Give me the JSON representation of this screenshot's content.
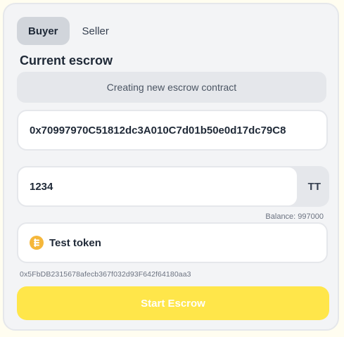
{
  "tabs": [
    {
      "label": "Buyer",
      "active": true
    },
    {
      "label": "Seller",
      "active": false
    }
  ],
  "section_title": "Current escrow",
  "status_text": "Creating new escrow contract",
  "address_value": "0x70997970C51812dc3A010C7d01b50e0d17dc79C8",
  "amount": {
    "value": "1234",
    "unit": "TT",
    "balance": "Balance: 997000"
  },
  "token": {
    "name": "Test token",
    "icon": "token-coin-icon",
    "address": "0x5FbDB2315678afecb367f032d93F642f64180aa3"
  },
  "start_button_label": "Start Escrow",
  "colors": {
    "accent": "#ffe64a",
    "card_bg": "#f3f4f6",
    "token_icon": "#f5b73b"
  }
}
